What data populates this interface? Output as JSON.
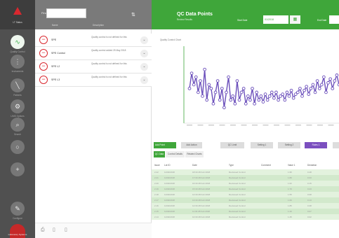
{
  "nav": {
    "logo_label": "LT Status",
    "items": [
      {
        "label": "Quality Control",
        "icon": "waveform-icon",
        "glyph": "∿",
        "active": true
      },
      {
        "label": "Instruments",
        "icon": "microscope-icon",
        "glyph": "⋮",
        "active": false
      },
      {
        "label": "Patients",
        "icon": "vial-icon",
        "glyph": "╲",
        "active": false
      },
      {
        "label": "LIMS Options",
        "icon": "gear-icon",
        "glyph": "⚙",
        "active": false
      },
      {
        "label": "Search",
        "icon": "magnifier-icon",
        "glyph": "⌕",
        "active": false
      },
      {
        "label": "",
        "icon": "circle-icon",
        "glyph": "○",
        "active": false
      },
      {
        "label": "",
        "icon": "plus-icon",
        "glyph": "+",
        "active": false
      },
      {
        "label": "Configure",
        "icon": "tools-icon",
        "glyph": "✎",
        "active": false
      }
    ],
    "brand_label": "Laboratory Systems"
  },
  "list": {
    "search_label": "Find",
    "search_value": "",
    "col_name": "Name",
    "col_desc": "Description",
    "rows": [
      {
        "name": "SPE",
        "desc": "Quality control is not defined for this"
      },
      {
        "name": "SPE Control",
        "desc": "Quality control added 25 May 2018"
      },
      {
        "name": "SPE L2",
        "desc": "Quality control is not defined for this"
      },
      {
        "name": "SPE L3",
        "desc": "Quality control is not defined for this"
      }
    ]
  },
  "header": {
    "title": "QC Data Points",
    "subtitle": "Review Results",
    "from_label": "Start Date",
    "from_value": "01/2018",
    "to_label": "End Date"
  },
  "toolbar": {
    "buttons": [
      "Add Point",
      "Add Action",
      "QC Limit",
      "Setting 1",
      "Setting 2",
      "Rules 1",
      ""
    ]
  },
  "tabs": [
    "QC Data",
    "Control Details",
    "Related Charts"
  ],
  "table": {
    "headers": [
      "Issue",
      "Lot ID",
      "Date",
      "Type",
      "Comment",
      "Value 1",
      "Deviation"
    ],
    "rows": [
      [
        "2.22",
        "11/02/2018",
        "18:30 28 Feb 2018",
        "Reviewed Control",
        "",
        "1.95",
        "0.48"
      ],
      [
        "2.21",
        "11/02/2018",
        "17:30 28 Feb 2018",
        "Reviewed Control",
        "",
        "1.80",
        "0.33"
      ],
      [
        "2.20",
        "11/02/2018",
        "16:30 28 Feb 2018",
        "Reviewed Control",
        "",
        "1.62",
        "0.15"
      ],
      [
        "2.19",
        "11/02/2018",
        "15:30 28 Feb 2018",
        "Reviewed Control",
        "",
        "1.70",
        "0.23"
      ],
      [
        "2.18",
        "11/02/2018",
        "14:30 28 Feb 2018",
        "Reviewed Control",
        "",
        "1.55",
        "0.08"
      ],
      [
        "2.17",
        "11/02/2018",
        "13:30 28 Feb 2018",
        "Reviewed Control",
        "",
        "1.60",
        "0.13"
      ],
      [
        "2.16",
        "11/02/2018",
        "12:30 28 Feb 2018",
        "Reviewed Control",
        "",
        "1.85",
        "0.38"
      ],
      [
        "2.15",
        "11/02/2018",
        "11:30 28 Feb 2018",
        "Reviewed Control",
        "",
        "1.40",
        "0.07"
      ],
      [
        "2.14",
        "11/02/2018",
        "10:30 28 Feb 2018",
        "Reviewed Control",
        "",
        "1.45",
        "0.02"
      ]
    ]
  },
  "chart_data": {
    "type": "line",
    "title": "Quality Control Chart",
    "ylim": [
      0.8,
      2.6
    ],
    "x": [
      1,
      2,
      3,
      4,
      5,
      6,
      7,
      8,
      9,
      10,
      11,
      12,
      13,
      14,
      15,
      16,
      17,
      18,
      19,
      20,
      21,
      22,
      23,
      24,
      25,
      26,
      27,
      28,
      29,
      30,
      31,
      32,
      33,
      34,
      35,
      36,
      37,
      38,
      39,
      40,
      41,
      42,
      43,
      44,
      45,
      46,
      47,
      48,
      49,
      50,
      51,
      52,
      53,
      54,
      55,
      56,
      57,
      58,
      59,
      60,
      61,
      62,
      63,
      64,
      65,
      66,
      67,
      68,
      69,
      70
    ],
    "series": [
      {
        "values": [
          1.6,
          2.0,
          1.7,
          1.9,
          1.5,
          1.8,
          1.4,
          2.1,
          1.3,
          1.7,
          1.6,
          1.2,
          1.5,
          1.8,
          1.3,
          1.6,
          1.1,
          1.5,
          1.9,
          1.3,
          1.4,
          1.2,
          1.8,
          1.3,
          1.5,
          1.6,
          1.2,
          1.4,
          1.3,
          1.6,
          1.2,
          1.5,
          1.3,
          1.4,
          1.25,
          1.45,
          1.3,
          1.4,
          1.5,
          1.35,
          1.5,
          1.3,
          1.4,
          1.45,
          1.3,
          1.5,
          1.4,
          1.55,
          1.35,
          1.45,
          1.5,
          1.6,
          1.4,
          1.55,
          1.65,
          1.45,
          1.6,
          1.7,
          1.5,
          1.8,
          1.6,
          1.7,
          1.9,
          1.5,
          1.75,
          1.85,
          1.6,
          1.8,
          1.95,
          1.7
        ]
      }
    ],
    "colors": {
      "line": "#6b4fbb",
      "marker_fill": "#ffffff",
      "marker_stroke": "#6b4fbb",
      "ref_line": "#3fa63a"
    },
    "grid": false
  },
  "colors": {
    "accent": "#3fa63a",
    "danger": "#d9282f",
    "purple": "#7b4fbf"
  }
}
